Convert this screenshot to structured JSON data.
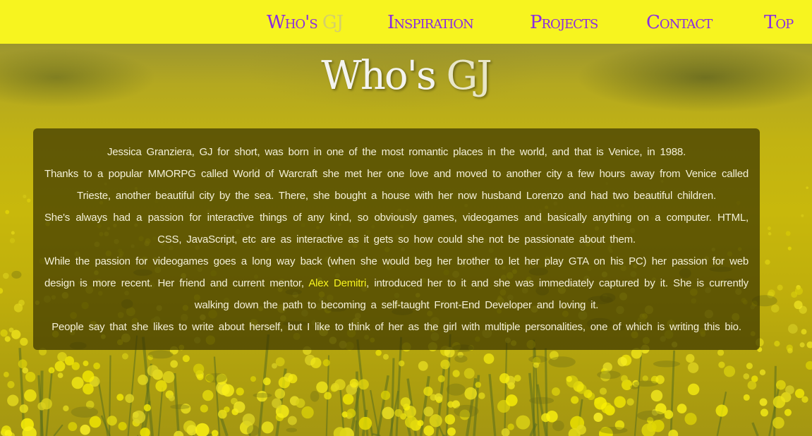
{
  "nav": {
    "items": [
      {
        "label_main": "Who's ",
        "label_accent": "GJ"
      },
      {
        "label": "Inspiration"
      },
      {
        "label": "Projects"
      },
      {
        "label": "Contact"
      },
      {
        "label": "Top"
      }
    ]
  },
  "colors": {
    "nav_background": "#f7f41f",
    "nav_text": "#8a2be2",
    "link_highlight": "#f7f41f",
    "panel_background": "rgba(55,50,0,0.70)",
    "body_text": "#f4f0d8"
  },
  "main": {
    "title_main": "Who's ",
    "title_accent": "GJ",
    "bio": {
      "p1": "Jessica Granziera, GJ for short, was born in one of the most romantic places in the world, and that is Venice, in 1988.",
      "p2": "Thanks to a popular MMORPG called World of Warcraft she met her one love and moved to another city a few hours away from Venice called Trieste, another beautiful city by the sea. There, she bought a house with her now husband Lorenzo and had two beautiful children.",
      "p3": "She's always had a passion for interactive things of any kind, so obviously games, videogames and basically anything on a computer. HTML, CSS, JavaScript, etc are as interactive as it gets so how could she not be passionate about them.",
      "p4_before": "While the passion for videogames goes a long way back (when she would beg her brother to let her play GTA on his PC) her passion for web design is more recent. Her friend and current mentor, ",
      "p4_link": "Alex Demitri",
      "p4_after": ", introduced her to it and she was immediately captured by it. She is currently walking down the path to becoming a self-taught Front-End Developer and loving it.",
      "p5": "People say that she likes to write about herself, but I like to think of her as the girl with multiple personalities, one of which is writing this bio."
    }
  }
}
